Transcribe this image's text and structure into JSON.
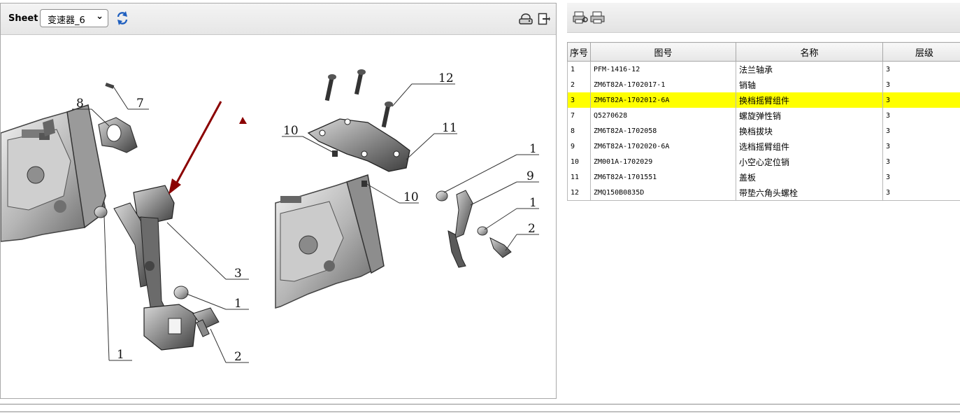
{
  "viewer": {
    "sheet_label": "Sheet",
    "sheet_value": "变速器_6",
    "icons": {
      "refresh": "refresh-icon",
      "print": "print-icon",
      "exit": "exit-icon"
    }
  },
  "diagram": {
    "callouts": [
      "1",
      "2",
      "3",
      "1",
      "7",
      "8",
      "12",
      "10",
      "11",
      "10",
      "1",
      "9",
      "1",
      "2"
    ],
    "accent_color": "#8b0000"
  },
  "parts_toolbar": {
    "icons": [
      "print-preview-icon",
      "print-icon"
    ]
  },
  "parts_table": {
    "columns": [
      "序号",
      "图号",
      "名称",
      "层级"
    ],
    "rows": [
      {
        "seq": "1",
        "part_no": "PFM-1416-12",
        "name": "法兰轴承",
        "level": "3"
      },
      {
        "seq": "2",
        "part_no": "ZM6T82A-1702017-1",
        "name": "销轴",
        "level": "3"
      },
      {
        "seq": "3",
        "part_no": "ZM6T82A-1702012-6A",
        "name": "换档摇臂组件",
        "level": "3"
      },
      {
        "seq": "7",
        "part_no": "Q5270628",
        "name": "螺旋弹性销",
        "level": "3"
      },
      {
        "seq": "8",
        "part_no": "ZM6T82A-1702058",
        "name": "换档拔块",
        "level": "3"
      },
      {
        "seq": "9",
        "part_no": "ZM6T82A-1702020-6A",
        "name": "选档摇臂组件",
        "level": "3"
      },
      {
        "seq": "10",
        "part_no": "ZM001A-1702029",
        "name": "小空心定位销",
        "level": "3"
      },
      {
        "seq": "11",
        "part_no": "ZM6T82A-1701551",
        "name": "盖板",
        "level": "3"
      },
      {
        "seq": "12",
        "part_no": "ZMQ150B0835D",
        "name": "带垫六角头螺栓",
        "level": "3"
      }
    ],
    "highlight_row": "3",
    "highlight_color": "#ffff00"
  }
}
